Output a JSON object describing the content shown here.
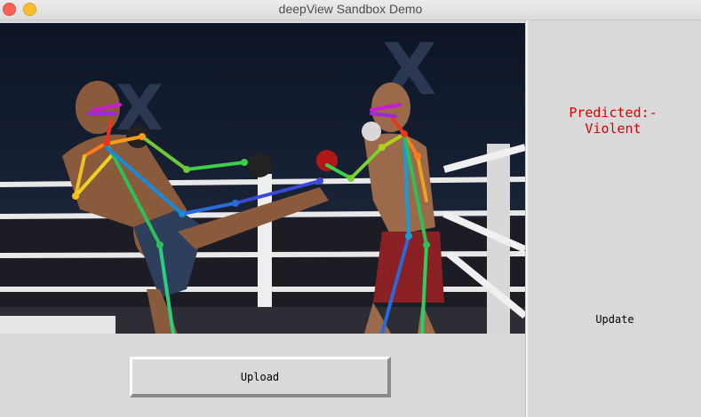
{
  "window": {
    "title": "deepView Sandbox Demo",
    "buttons": [
      "close-icon",
      "minimize-icon"
    ]
  },
  "image_panel": {
    "description_icon": "pose-estimation-photo",
    "brand_mark": "X"
  },
  "result_panel": {
    "prediction_line1": "Predicted:-",
    "prediction_line2": "Violent",
    "prediction_color": "#e00000",
    "update_label": "Update"
  },
  "controls": {
    "upload_label": "Upload"
  }
}
